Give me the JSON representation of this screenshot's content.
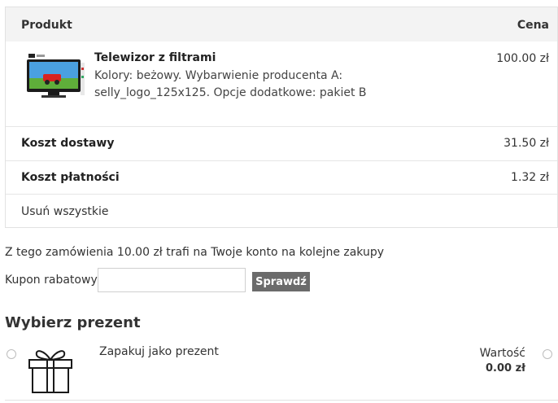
{
  "cart": {
    "header": {
      "product_label": "Produkt",
      "price_label": "Cena"
    },
    "item": {
      "image_icon": "tv-product-image",
      "name": "Telewizor z filtrami",
      "description": "Kolory: beżowy. Wybarwienie producenta A: selly_logo_125x125. Opcje dodatkowe: pakiet B",
      "price": "100.00 zł"
    },
    "shipping": {
      "label": "Koszt dostawy",
      "value": "31.50 zł"
    },
    "payment": {
      "label": "Koszt płatności",
      "value": "1.32 zł"
    },
    "remove_all": "Usuń wszystkie"
  },
  "points_text": "Z tego zamówienia 10.00 zł trafi na Twoje konto na kolejne zakupy",
  "coupon": {
    "label": "Kupon rabatowy:",
    "value": "",
    "button_label": "Sprawdź"
  },
  "gift": {
    "title": "Wybierz prezent",
    "option": {
      "icon": "gift-box-icon",
      "label": "Zapakuj jako prezent",
      "value_label": "Wartość",
      "value": "0.00 zł"
    }
  },
  "colors": {
    "header_bg": "#f3f3f3",
    "button_bg": "#6b6b6b",
    "border": "#e2e2e2"
  }
}
